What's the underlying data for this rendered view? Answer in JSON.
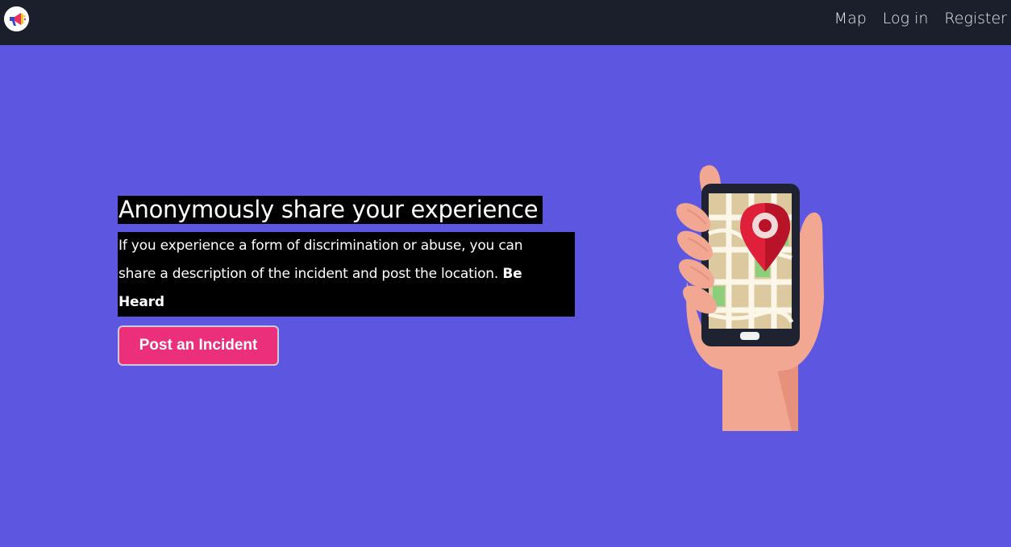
{
  "nav": {
    "logo_icon": "megaphone-logo-icon",
    "links": [
      "Map",
      "Log in",
      "Register"
    ]
  },
  "hero": {
    "title": "Anonymously share your experience",
    "description": "If you experience a form of discrimination or abuse, you can share a description of the incident and post the location.",
    "description_bold": "Be Heard",
    "cta_label": "Post an Incident"
  },
  "illustration": {
    "icon": "hand-holding-phone-map-pin-illustration"
  },
  "colors": {
    "background": "#5c56e0",
    "navbar": "#1b1f2c",
    "cta": "#ec2f7b",
    "pin": "#e0203a"
  }
}
